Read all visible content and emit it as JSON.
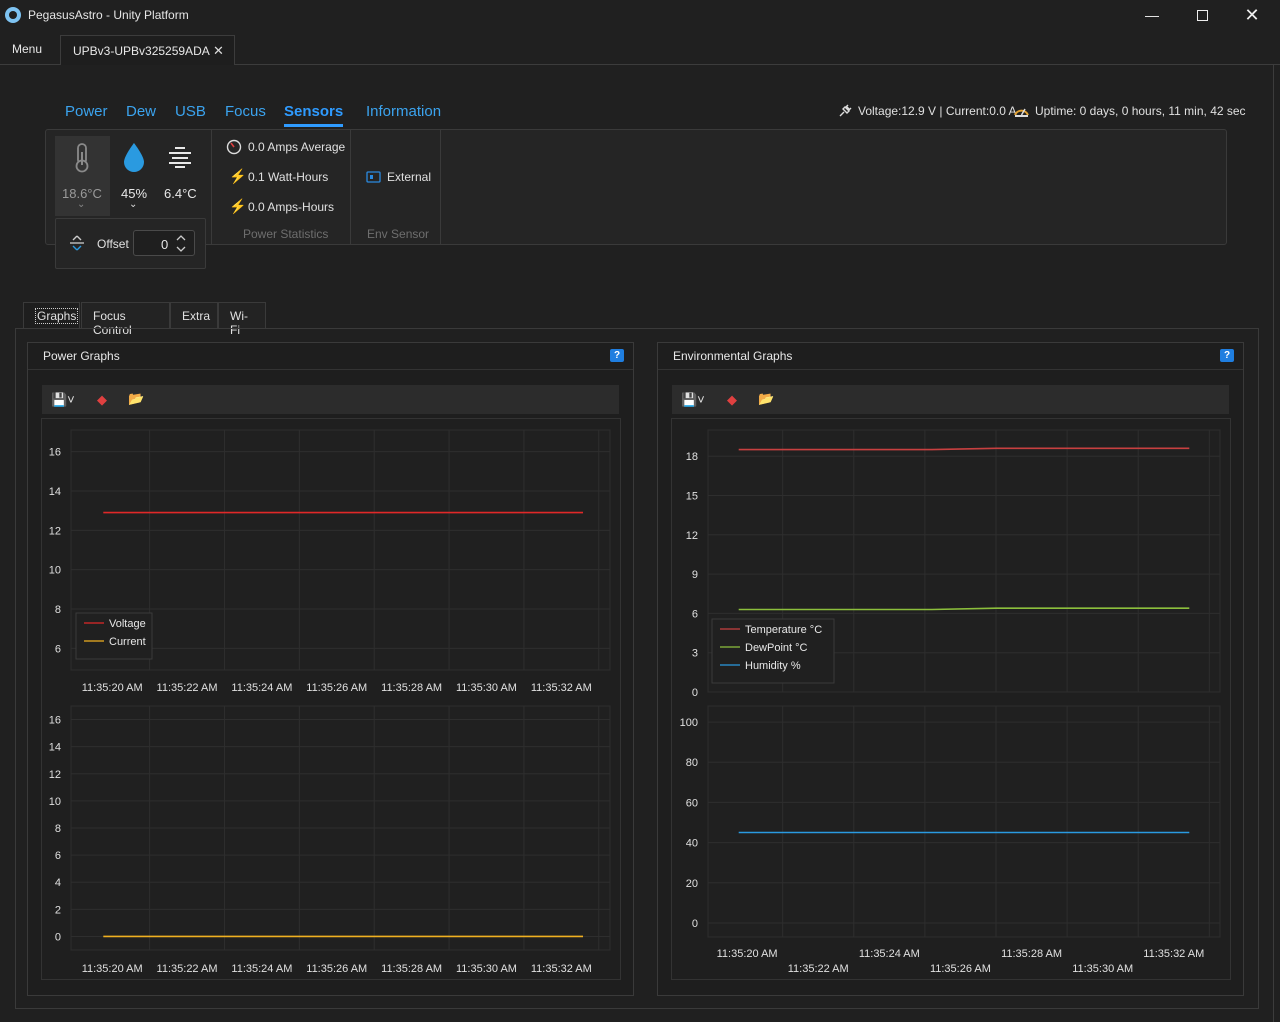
{
  "window": {
    "title": "PegasusAstro - Unity Platform"
  },
  "tabstrip": {
    "menu_label": "Menu",
    "device_tab_label": "UPBv3-UPBv325259ADA"
  },
  "nav_tabs": [
    {
      "label": "Power"
    },
    {
      "label": "Dew"
    },
    {
      "label": "USB"
    },
    {
      "label": "Focus"
    },
    {
      "label": "Sensors",
      "active": true
    },
    {
      "label": "Information"
    }
  ],
  "status": {
    "voltage_current": "Voltage:12.9 V | Current:0.0 A",
    "uptime": "Uptime: 0 days, 0 hours, 11 min, 42 sec"
  },
  "sensors": {
    "temperature": "18.6°C",
    "humidity": "45%",
    "dewpoint": "6.4°C",
    "offset_label": "Offset",
    "offset_value": "0"
  },
  "power_stats": {
    "caption": "Power Statistics",
    "amps_average": "0.0 Amps Average",
    "watt_hours": "0.1 Watt-Hours",
    "amp_hours": "0.0 Amps-Hours"
  },
  "env_sensor": {
    "caption": "Env Sensor",
    "label": "External"
  },
  "bottom_tabs": [
    {
      "label": "Graphs",
      "active": true
    },
    {
      "label": "Focus Control"
    },
    {
      "label": "Extra"
    },
    {
      "label": "Wi-Fi"
    }
  ],
  "power_graphs": {
    "title": "Power Graphs"
  },
  "env_graphs": {
    "title": "Environmental Graphs"
  },
  "colors": {
    "accent": "#2f9bff",
    "voltage": "#e02828",
    "current": "#f0b020",
    "temperature": "#c84040",
    "dewpoint": "#8cbf3c",
    "humidity": "#2a9ae0"
  },
  "chart_data": [
    {
      "type": "line",
      "name": "power-voltage",
      "x": [
        "11:35:20 AM",
        "11:35:22 AM",
        "11:35:24 AM",
        "11:35:26 AM",
        "11:35:28 AM",
        "11:35:30 AM",
        "11:35:32 AM"
      ],
      "series": [
        {
          "name": "Voltage",
          "values": [
            12.9,
            12.9,
            12.9,
            12.9,
            12.9,
            12.9,
            12.9,
            12.9
          ]
        },
        {
          "name": "Current",
          "values": []
        }
      ],
      "yticks": [
        6,
        8,
        10,
        12,
        14,
        16
      ],
      "ylim": [
        4.9,
        17.1
      ],
      "legend": "bottom-left"
    },
    {
      "type": "line",
      "name": "power-current",
      "x": [
        "11:35:20 AM",
        "11:35:22 AM",
        "11:35:24 AM",
        "11:35:26 AM",
        "11:35:28 AM",
        "11:35:30 AM",
        "11:35:32 AM"
      ],
      "series": [
        {
          "name": "Current",
          "values": [
            0,
            0,
            0,
            0,
            0,
            0,
            0,
            0
          ]
        }
      ],
      "yticks": [
        0,
        2,
        4,
        6,
        8,
        10,
        12,
        14,
        16
      ],
      "ylim": [
        -1,
        17
      ]
    },
    {
      "type": "line",
      "name": "env-temp-dew",
      "x": [
        "11:35:20 AM",
        "11:35:22 AM",
        "11:35:24 AM",
        "11:35:26 AM",
        "11:35:28 AM",
        "11:35:30 AM",
        "11:35:32 AM"
      ],
      "series": [
        {
          "name": "Temperature °C",
          "values": [
            18.5,
            18.5,
            18.5,
            18.5,
            18.6,
            18.6,
            18.6,
            18.6
          ]
        },
        {
          "name": "DewPoint °C",
          "values": [
            6.3,
            6.3,
            6.3,
            6.3,
            6.4,
            6.4,
            6.4,
            6.4
          ]
        },
        {
          "name": "Humidity %",
          "values": []
        }
      ],
      "yticks": [
        0,
        3,
        6,
        9,
        12,
        15,
        18
      ],
      "ylim": [
        0,
        20
      ],
      "legend": "bottom-left"
    },
    {
      "type": "line",
      "name": "env-humidity",
      "x": [
        "11:35:20 AM",
        "11:35:22 AM",
        "11:35:24 AM",
        "11:35:26 AM",
        "11:35:28 AM",
        "11:35:30 AM",
        "11:35:32 AM"
      ],
      "series": [
        {
          "name": "Humidity %",
          "values": [
            45,
            45,
            45,
            45,
            45,
            45,
            45,
            45
          ]
        }
      ],
      "yticks": [
        0,
        20,
        40,
        60,
        80,
        100
      ],
      "ylim": [
        -7,
        108
      ]
    }
  ]
}
